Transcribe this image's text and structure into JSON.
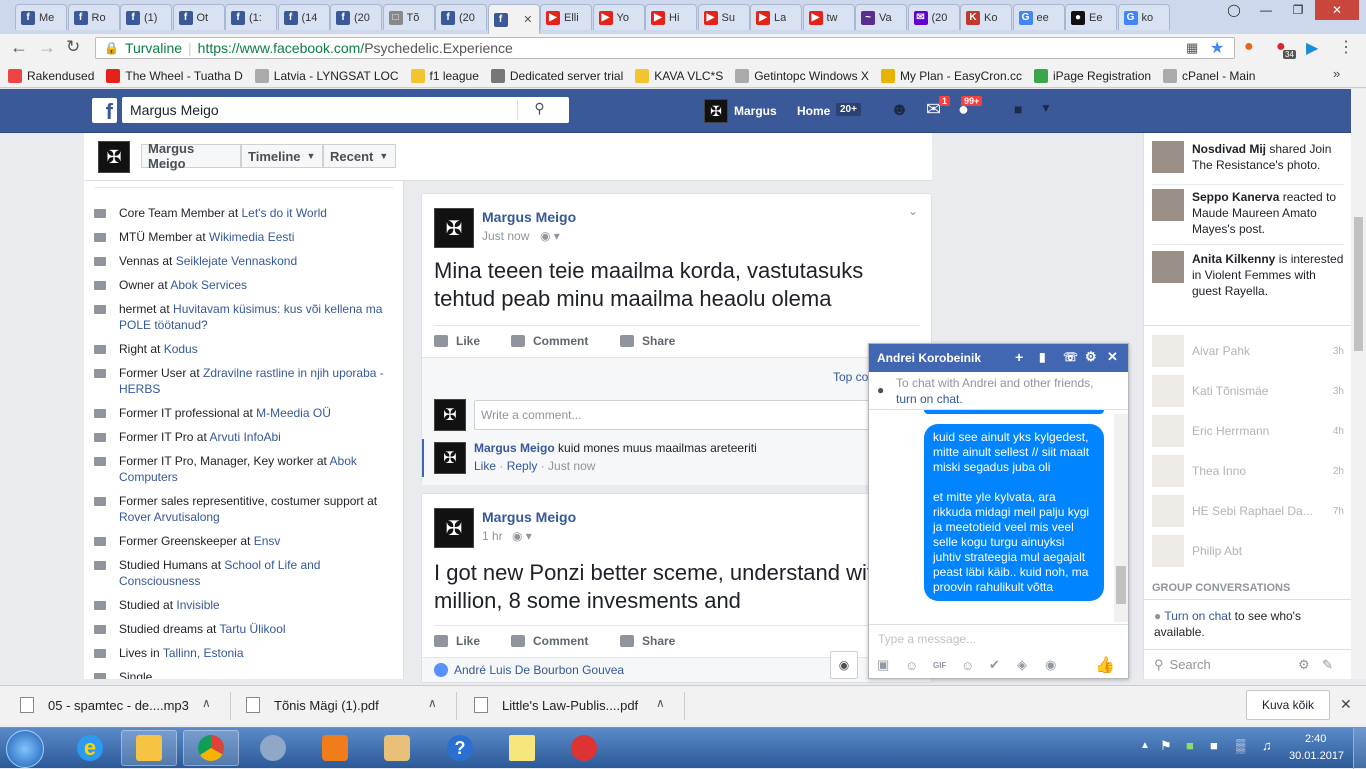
{
  "browser": {
    "tabs": [
      {
        "label": "Me",
        "icon": "facebook-icon",
        "color": "#3b5998"
      },
      {
        "label": "Ro",
        "icon": "facebook-icon",
        "color": "#3b5998"
      },
      {
        "label": "(1)",
        "icon": "facebook-icon",
        "color": "#3b5998"
      },
      {
        "label": "Ot",
        "icon": "facebook-icon",
        "color": "#3b5998"
      },
      {
        "label": "(1:",
        "icon": "facebook-icon",
        "color": "#3b5998"
      },
      {
        "label": "(14",
        "icon": "facebook-icon",
        "color": "#3b5998"
      },
      {
        "label": "(20",
        "icon": "facebook-icon",
        "color": "#3b5998"
      },
      {
        "label": "Tõ",
        "icon": "document-icon",
        "color": "#888888"
      },
      {
        "label": "(20",
        "icon": "facebook-icon",
        "color": "#3b5998"
      },
      {
        "label": "",
        "icon": "facebook-icon",
        "color": "#3b5998"
      },
      {
        "label": "Elli",
        "icon": "youtube-icon",
        "color": "#e62117"
      },
      {
        "label": "Yo",
        "icon": "youtube-icon",
        "color": "#e62117"
      },
      {
        "label": "Hi",
        "icon": "youtube-icon",
        "color": "#e62117"
      },
      {
        "label": "Su",
        "icon": "youtube-icon",
        "color": "#e62117"
      },
      {
        "label": "La",
        "icon": "youtube-icon",
        "color": "#e62117"
      },
      {
        "label": "tw",
        "icon": "youtube-icon",
        "color": "#e62117"
      },
      {
        "label": "Va",
        "icon": "wave-icon",
        "color": "#5a2d91"
      },
      {
        "label": "(20",
        "icon": "yahoo-mail-icon",
        "color": "#5f01d1"
      },
      {
        "label": "Ko",
        "icon": "k-icon",
        "color": "#c0392b"
      },
      {
        "label": "ee",
        "icon": "google-icon",
        "color": "#4285f4"
      },
      {
        "label": "Ee",
        "icon": "globe-icon",
        "color": "#111111"
      },
      {
        "label": "ko",
        "icon": "google-icon",
        "color": "#4285f4"
      }
    ],
    "address": {
      "secure_label": "Turvaline",
      "url_prefix": "https://www.facebook.com/",
      "url_path": "Psychedelic.Experience"
    },
    "ext_badge": "34",
    "bookmarks": [
      {
        "label": "Rakendused",
        "color": "#e44"
      },
      {
        "label": "The Wheel - Tuatha D",
        "color": "#e62117"
      },
      {
        "label": "Latvia - LYNGSAT LOC",
        "color": "#aaa"
      },
      {
        "label": "f1 league",
        "color": "#f4c430"
      },
      {
        "label": "Dedicated server trial",
        "color": "#777"
      },
      {
        "label": "KAVA VLC*S",
        "color": "#f4c430"
      },
      {
        "label": "Getintopc Windows X",
        "color": "#aaa"
      },
      {
        "label": "My Plan - EasyCron.cc",
        "color": "#e8b400"
      },
      {
        "label": "iPage Registration",
        "color": "#3aa64a"
      },
      {
        "label": "cPanel - Main",
        "color": "#aaa"
      }
    ]
  },
  "fb": {
    "search_value": "Margus Meigo",
    "user_name": "Margus",
    "home_label": "Home",
    "home_count": "20+",
    "msg_badge": "1",
    "notif_badge": "99+"
  },
  "profile": {
    "name_button": "Margus Meigo",
    "timeline_button": "Timeline",
    "recent_button": "Recent"
  },
  "intro": [
    {
      "pre": "Core Team Member at ",
      "link": "Let's do it World"
    },
    {
      "pre": "MTÜ Member at ",
      "link": "Wikimedia Eesti"
    },
    {
      "pre": "Vennas at ",
      "link": "Seiklejate Vennaskond"
    },
    {
      "pre": "Owner at ",
      "link": "Abok Services"
    },
    {
      "pre": "hermet at ",
      "link": "Huvitavam küsimus: kus või kellena ma POLE töötanud?"
    },
    {
      "pre": "Right at ",
      "link": "Kodus"
    },
    {
      "pre": "Former User at ",
      "link": "Zdravilne rastline in njih uporaba - HERBS"
    },
    {
      "pre": "Former IT professional at ",
      "link": "M-Meedia OÜ"
    },
    {
      "pre": "Former IT Pro at ",
      "link": "Arvuti InfoAbi"
    },
    {
      "pre": "Former IT Pro, Manager, Key worker at ",
      "link": "Abok Computers"
    },
    {
      "pre": "Former sales representitive, costumer support at ",
      "link": "Rover Arvutisalong"
    },
    {
      "pre": "Former Greenskeeper at ",
      "link": "Ensv"
    },
    {
      "pre": "Studied Humans at ",
      "link": "School of Life and Consciousness"
    },
    {
      "pre": "Studied at ",
      "link": "Invisible"
    },
    {
      "pre": "Studied dreams at ",
      "link": "Tartu Ülikool"
    },
    {
      "pre": "Lives in ",
      "link": "Tallinn, Estonia"
    },
    {
      "pre": "Single",
      "link": ""
    }
  ],
  "posts": [
    {
      "author": "Margus Meigo",
      "time": "Just now",
      "text": "Mina teeen teie maailma korda, vastutasuks tehtud peab minu maailma heaolu olema",
      "like": "Like",
      "comment": "Comment",
      "share": "Share",
      "top_comments": "Top co",
      "write_placeholder": "Write a comment...",
      "comment_author": "Margus Meigo",
      "comment_text": "kuid mones muus maailmas areteeriti",
      "comment_like": "Like",
      "comment_reply": "Reply",
      "comment_time": "Just now"
    },
    {
      "author": "Margus Meigo",
      "time": "1 hr",
      "text": "I got new Ponzi better sceme, understand with 1 million, 8 some invesments and",
      "like": "Like",
      "comment": "Comment",
      "share": "Share",
      "liker": "André Luis De Bourbon Gouvea"
    }
  ],
  "ticker": [
    {
      "name": "Nosdivad Mij",
      "text": " shared Join The Resistance's photo."
    },
    {
      "name": "Seppo Kanerva",
      "text": " reacted to Maude Maureen Amato Mayes's post."
    },
    {
      "name": "Anita Kilkenny",
      "text": " is interested in Violent Femmes with guest Rayella."
    }
  ],
  "friends": [
    {
      "name": "Aivar Pahk",
      "time": "3h"
    },
    {
      "name": "Kati Tõnismäe",
      "time": "3h"
    },
    {
      "name": "Eric Herrmann",
      "time": "4h"
    },
    {
      "name": "Thea Inno",
      "time": "2h"
    },
    {
      "name": "HE Sebi Raphael Da...",
      "time": "7h"
    },
    {
      "name": "Philip Abt",
      "time": ""
    }
  ],
  "sidebar": {
    "group_header": "GROUP CONVERSATIONS",
    "turn_on": "Turn on chat",
    "turn_on_rest": " to see who's available.",
    "search": "Search"
  },
  "chat": {
    "title": "Andrei Korobeinik",
    "notice_pre": "To chat with Andrei and other friends,",
    "notice_link": "turn on chat.",
    "message_1": "kuid see ainult yks kylgedest, mitte ainult sellest // siit maalt miski segadus juba oli",
    "message_2": "et mitte yle kylvata, ara rikkuda midagi meil palju kygi ja meetotieid veel mis veel selle kogu turgu ainuyksi juhtiv strateegia mul aegajalt peast läbi käib.. kuid noh, ma proovin rahulikult võtta",
    "placeholder": "Type a message...",
    "gif": "GIF"
  },
  "downloads": {
    "items": [
      "05 - spamtec - de....mp3",
      "Tõnis Mägi (1).pdf",
      "Little's Law-Publis....pdf"
    ],
    "show_all": "Kuva kõik"
  },
  "taskbar": {
    "time": "2:40",
    "date": "30.01.2017"
  }
}
